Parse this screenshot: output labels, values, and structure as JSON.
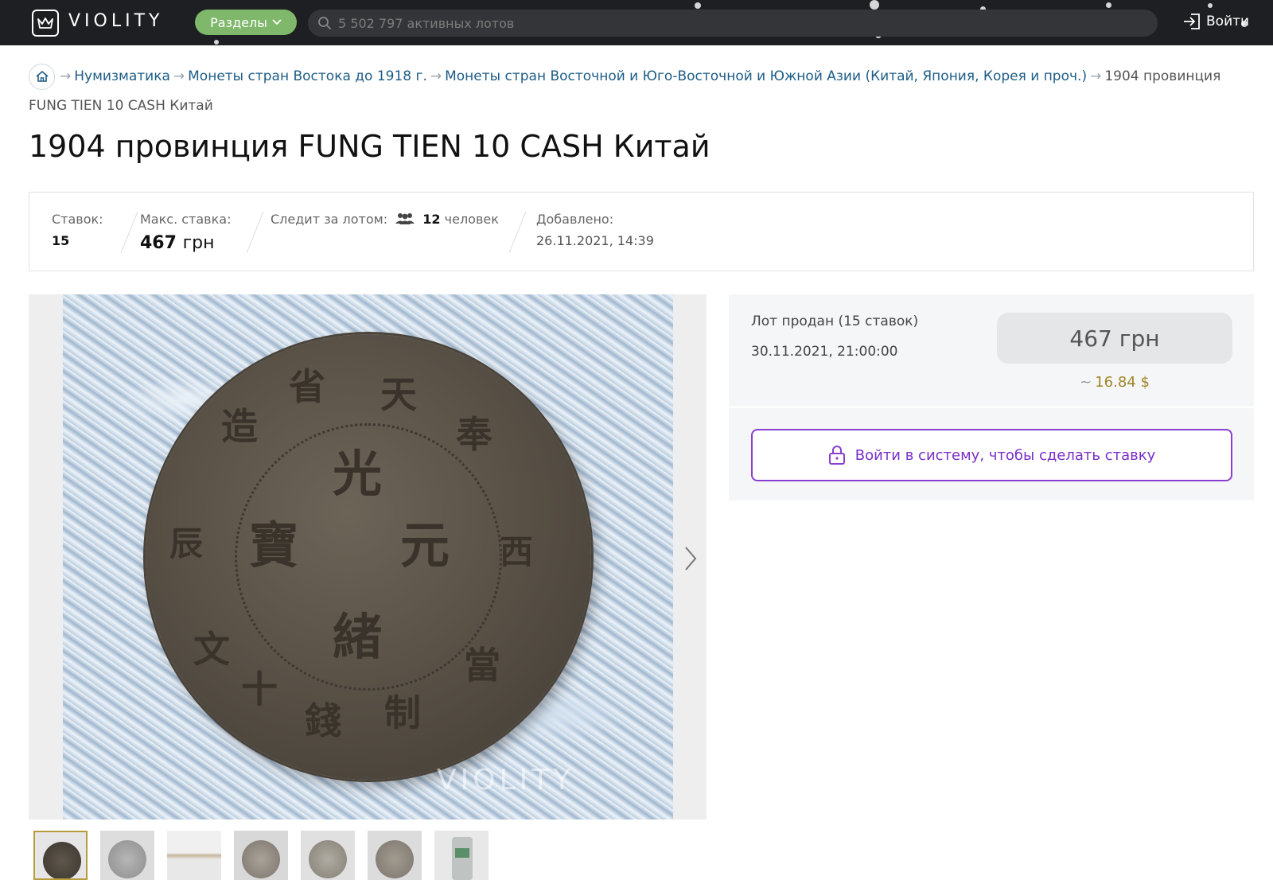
{
  "header": {
    "logo_text": "VIOLITY",
    "sections_label": "Разделы",
    "search_placeholder": "5 502 797 активных лотов",
    "login_label": "Войти"
  },
  "breadcrumbs": {
    "items": [
      "Нумизматика",
      "Монеты стран Востока до 1918 г.",
      "Монеты стран Восточной и Юго-Восточной и Южной Азии (Китай, Япония, Корея и проч.)"
    ],
    "current": "1904 провинция FUNG TIEN 10 CASH Китай"
  },
  "title": "1904 провинция FUNG TIEN 10 CASH Китай",
  "stats": {
    "bids_label": "Ставок:",
    "bids_value": "15",
    "max_bid_label": "Макс. ставка:",
    "max_bid_value": "467",
    "max_bid_unit": "грн",
    "watchers_label": "Следит за лотом:",
    "watchers_value": "12",
    "watchers_unit": "человек",
    "added_label": "Добавлено:",
    "added_value": "26.11.2021, 14:39"
  },
  "gallery": {
    "watermark": "VIOLITY",
    "thumb_count": 7,
    "active_thumb": 0
  },
  "sale": {
    "status": "Лот продан (15 ставок)",
    "date": "30.11.2021, 21:00:00",
    "price": "467 грн",
    "usd_tilde": "~",
    "usd": "16.84 $"
  },
  "login_cta": "Войти в систему, чтобы сделать ставку",
  "colors": {
    "topbar": "#1e1f22",
    "sections_green": "#7fb86a",
    "link_blue": "#1d5c86",
    "cta_purple": "#8a3fd1",
    "usd_gold": "#a08429"
  }
}
